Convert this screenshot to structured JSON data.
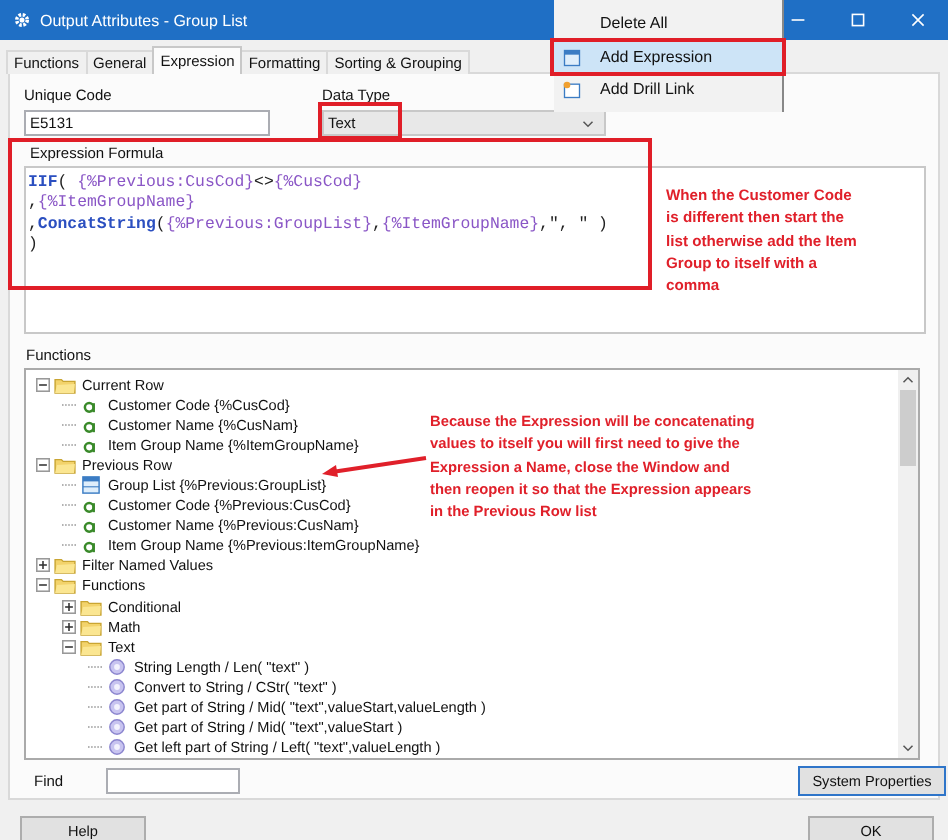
{
  "window": {
    "title": "Output Attributes - Group List"
  },
  "context_menu": {
    "items": [
      {
        "label": "Delete All",
        "kind": "plain",
        "highlighted": false
      },
      {
        "label": "Add Expression",
        "kind": "expression",
        "highlighted": true
      },
      {
        "label": "Add Drill Link",
        "kind": "link",
        "highlighted": false
      }
    ]
  },
  "tabs": [
    {
      "label": "Functions",
      "selected": false
    },
    {
      "label": "General",
      "selected": false
    },
    {
      "label": "Expression",
      "selected": true
    },
    {
      "label": "Formatting",
      "selected": false
    },
    {
      "label": "Sorting & Grouping",
      "selected": false
    }
  ],
  "unique_code": {
    "label": "Unique Code",
    "value": "E5131"
  },
  "data_type": {
    "label": "Data Type",
    "value": "Text",
    "highlighted": true
  },
  "expression_formula": {
    "label": "Expression Formula",
    "highlighted": true,
    "lines": [
      [
        {
          "kind": "keyword",
          "text": "IIF"
        },
        {
          "kind": "plain",
          "text": "( "
        },
        {
          "kind": "variable",
          "text": "{%Previous:CusCod}"
        },
        {
          "kind": "plain",
          "text": "<>"
        },
        {
          "kind": "variable",
          "text": "{%CusCod}"
        }
      ],
      [
        {
          "kind": "plain",
          "text": ","
        },
        {
          "kind": "variable",
          "text": "{%ItemGroupName}"
        }
      ],
      [
        {
          "kind": "plain",
          "text": ","
        },
        {
          "kind": "keyword",
          "text": "ConcatString"
        },
        {
          "kind": "plain",
          "text": "("
        },
        {
          "kind": "variable",
          "text": "{%Previous:GroupList}"
        },
        {
          "kind": "plain",
          "text": ","
        },
        {
          "kind": "variable",
          "text": "{%ItemGroupName}"
        },
        {
          "kind": "plain",
          "text": ",\", \" )"
        }
      ],
      [
        {
          "kind": "plain",
          "text": ")"
        }
      ]
    ]
  },
  "annotations": [
    {
      "text": "When the Customer Code\nis different then start the\nlist otherwise add the Item\nGroup to itself with a\ncomma"
    },
    {
      "text": "Because the Expression will be concatenating\nvalues to itself you will first need to give the\nExpression a Name, close the Window and\nthen reopen it so that the Expression appears\nin the Previous Row list"
    }
  ],
  "functions": {
    "label": "Functions",
    "tree": [
      {
        "label": "Current Row",
        "kind": "folder",
        "expanded": true,
        "children": [
          {
            "label": "Customer Code  {%CusCod}",
            "kind": "field"
          },
          {
            "label": "Customer Name  {%CusNam}",
            "kind": "field"
          },
          {
            "label": "Item Group Name  {%ItemGroupName}",
            "kind": "field"
          }
        ]
      },
      {
        "label": "Previous Row",
        "kind": "folder",
        "expanded": true,
        "children": [
          {
            "label": "Group List  {%Previous:GroupList}",
            "kind": "expression"
          },
          {
            "label": "Customer Code  {%Previous:CusCod}",
            "kind": "field"
          },
          {
            "label": "Customer Name  {%Previous:CusNam}",
            "kind": "field"
          },
          {
            "label": "Item Group Name  {%Previous:ItemGroupName}",
            "kind": "field"
          }
        ]
      },
      {
        "label": "Filter Named Values",
        "kind": "folder",
        "expanded": false
      },
      {
        "label": "Functions",
        "kind": "folder",
        "expanded": true,
        "children": [
          {
            "label": "Conditional",
            "kind": "folder",
            "expanded": false
          },
          {
            "label": "Math",
            "kind": "folder",
            "expanded": false
          },
          {
            "label": "Text",
            "kind": "folder",
            "expanded": true,
            "children": [
              {
                "label": "String Length / Len( \"text\" )",
                "kind": "function"
              },
              {
                "label": "Convert to String / CStr( \"text\" )",
                "kind": "function"
              },
              {
                "label": "Get part of String / Mid( \"text\",valueStart,valueLength )",
                "kind": "function"
              },
              {
                "label": "Get part of String / Mid( \"text\",valueStart )",
                "kind": "function"
              },
              {
                "label": "Get left part of String / Left( \"text\",valueLength )",
                "kind": "function"
              }
            ]
          }
        ]
      }
    ]
  },
  "find": {
    "label": "Find"
  },
  "buttons": {
    "system_properties": "System Properties",
    "help": "Help",
    "ok": "OK"
  }
}
